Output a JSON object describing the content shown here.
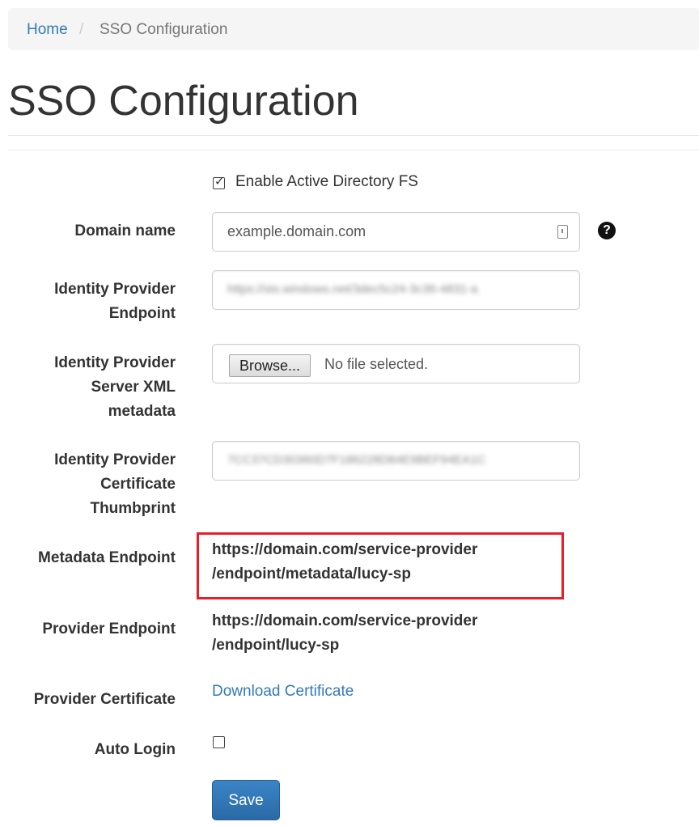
{
  "breadcrumb": {
    "home": "Home",
    "separator": "/",
    "current": "SSO Configuration"
  },
  "page_title": "SSO Configuration",
  "enable_adfs": {
    "label": "Enable Active Directory FS",
    "checked": true
  },
  "domain_name": {
    "label": "Domain name",
    "value": "example.domain.com",
    "help_icon": "question-circle-icon",
    "field_icon": "password-manager-icon"
  },
  "idp_endpoint": {
    "label_line1": "Identity Provider",
    "label_line2": "Endpoint",
    "value": "https://sts.windows.net/3dec5c24-3c36-4831-a"
  },
  "idp_xml": {
    "label_line1": "Identity Provider",
    "label_line2": "Server XML",
    "label_line3": "metadata",
    "browse_label": "Browse...",
    "file_status": "No file selected."
  },
  "idp_thumbprint": {
    "label_line1": "Identity Provider",
    "label_line2": "Certificate",
    "label_line3": "Thumbprint",
    "value": "7CC37CD30360D7F186228D84E9BEF94EA1C"
  },
  "metadata_endpoint": {
    "label": "Metadata Endpoint",
    "line1": "https://domain.com/service-provider",
    "line2": "/endpoint/metadata/lucy-sp",
    "highlight_color": "#e4202b"
  },
  "provider_endpoint": {
    "label": "Provider Endpoint",
    "line1": "https://domain.com/service-provider",
    "line2": "/endpoint/lucy-sp"
  },
  "provider_certificate": {
    "label": "Provider Certificate",
    "link_text": "Download Certificate"
  },
  "auto_login": {
    "label": "Auto Login",
    "checked": false
  },
  "save_label": "Save",
  "colors": {
    "link": "#337ab7",
    "primary_button": "#2c6fad",
    "highlight": "#e4202b"
  }
}
